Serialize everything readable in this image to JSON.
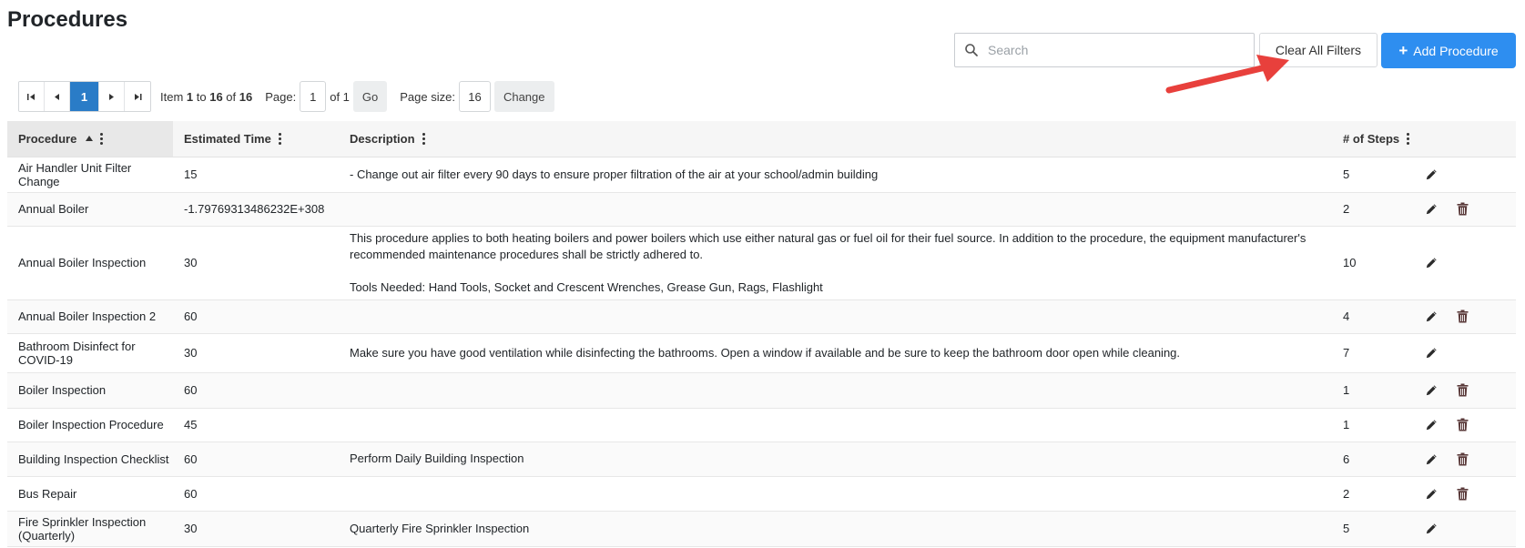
{
  "page": {
    "title": "Procedures"
  },
  "toolbar": {
    "search_placeholder": "Search",
    "clear_filters_label": "Clear All Filters",
    "add_label": "Add Procedure",
    "add_icon": "plus-icon"
  },
  "pager": {
    "current_page": "1",
    "item_prefix": "Item ",
    "item_from": "1",
    "item_to_label": " to ",
    "item_to": "16",
    "item_of_label": " of ",
    "item_total": "16",
    "page_label": "Page:",
    "page_value": "1",
    "page_of": "of 1",
    "go_label": "Go",
    "page_size_label": "Page size:",
    "page_size_value": "16",
    "change_label": "Change"
  },
  "columns": {
    "procedure": "Procedure",
    "estimated_time": "Estimated Time",
    "description": "Description",
    "steps": "# of Steps"
  },
  "rows": [
    {
      "procedure": "Air Handler Unit Filter Change",
      "time": "15",
      "description": [
        "- Change out air filter every 90 days to ensure proper filtration of the air at your school/admin building"
      ],
      "steps": "5",
      "deletable": false
    },
    {
      "procedure": "Annual Boiler",
      "time": "-1.79769313486232E+308",
      "description": [
        ""
      ],
      "steps": "2",
      "deletable": true
    },
    {
      "procedure": "Annual Boiler Inspection",
      "time": "30",
      "description": [
        "This procedure applies to both heating boilers and power boilers which use either natural gas or fuel oil for their fuel source. In addition to the procedure, the equipment manufacturer's",
        "recommended maintenance procedures shall be strictly adhered to.",
        "",
        "Tools Needed: Hand Tools, Socket and Crescent Wrenches, Grease Gun, Rags, Flashlight"
      ],
      "steps": "10",
      "deletable": false
    },
    {
      "procedure": "Annual Boiler Inspection 2",
      "time": "60",
      "description": [
        ""
      ],
      "steps": "4",
      "deletable": true
    },
    {
      "procedure": "Bathroom Disinfect for COVID-19",
      "time": "30",
      "description": [
        "Make sure you have good ventilation while disinfecting the bathrooms. Open a window if available and be sure to keep the bathroom door open while cleaning."
      ],
      "steps": "7",
      "deletable": false
    },
    {
      "procedure": "Boiler Inspection",
      "time": "60",
      "description": [
        ""
      ],
      "steps": "1",
      "deletable": true
    },
    {
      "procedure": "Boiler Inspection Procedure",
      "time": "45",
      "description": [
        ""
      ],
      "steps": "1",
      "deletable": true
    },
    {
      "procedure": "Building Inspection Checklist",
      "time": "60",
      "description": [
        "Perform Daily Building Inspection"
      ],
      "steps": "6",
      "deletable": true
    },
    {
      "procedure": "Bus Repair",
      "time": "60",
      "description": [
        ""
      ],
      "steps": "2",
      "deletable": true
    },
    {
      "procedure": "Fire Sprinkler Inspection (Quarterly)",
      "time": "30",
      "description": [
        "Quarterly Fire Sprinkler Inspection"
      ],
      "steps": "5",
      "deletable": false
    }
  ],
  "colors": {
    "primary": "#2e8ef0",
    "active_page": "#2a7cc7",
    "annotation_arrow": "#e8403c",
    "delete_icon": "#5a3a3a"
  }
}
